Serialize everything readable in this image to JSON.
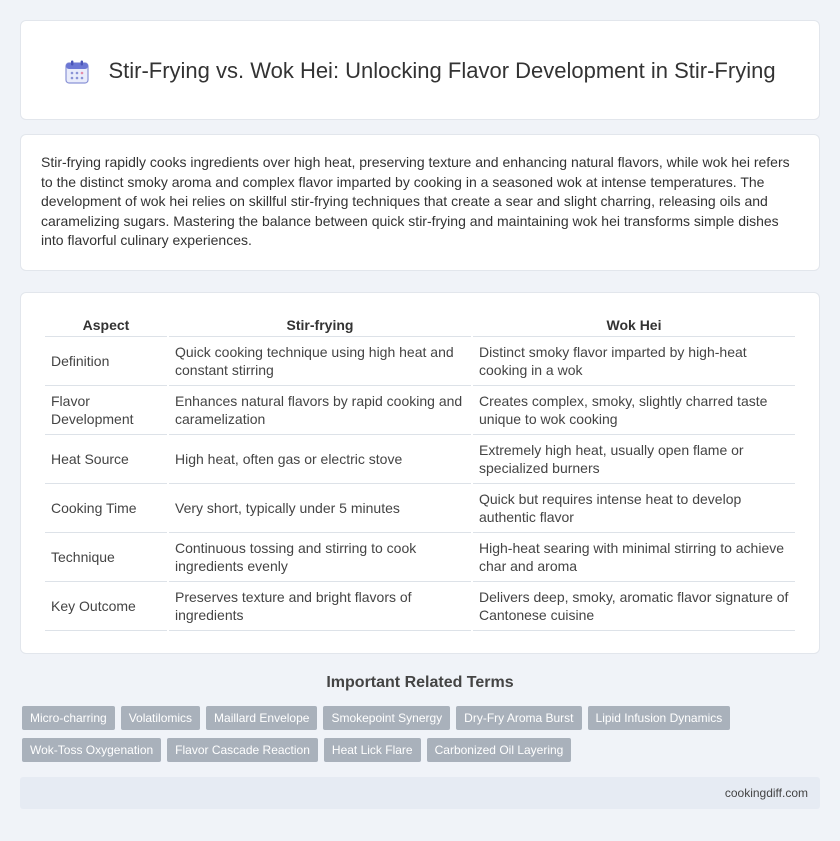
{
  "header": {
    "title": "Stir-Frying vs. Wok Hei: Unlocking Flavor Development in Stir-Frying",
    "icon": "calendar-icon"
  },
  "intro": {
    "text": "Stir-frying rapidly cooks ingredients over high heat, preserving texture and enhancing natural flavors, while wok hei refers to the distinct smoky aroma and complex flavor imparted by cooking in a seasoned wok at intense temperatures. The development of wok hei relies on skillful stir-frying techniques that create a sear and slight charring, releasing oils and caramelizing sugars. Mastering the balance between quick stir-frying and maintaining wok hei transforms simple dishes into flavorful culinary experiences."
  },
  "table": {
    "headers": [
      "Aspect",
      "Stir-frying",
      "Wok Hei"
    ],
    "rows": [
      [
        "Definition",
        "Quick cooking technique using high heat and constant stirring",
        "Distinct smoky flavor imparted by high-heat cooking in a wok"
      ],
      [
        "Flavor Development",
        "Enhances natural flavors by rapid cooking and caramelization",
        "Creates complex, smoky, slightly charred taste unique to wok cooking"
      ],
      [
        "Heat Source",
        "High heat, often gas or electric stove",
        "Extremely high heat, usually open flame or specialized burners"
      ],
      [
        "Cooking Time",
        "Very short, typically under 5 minutes",
        "Quick but requires intense heat to develop authentic flavor"
      ],
      [
        "Technique",
        "Continuous tossing and stirring to cook ingredients evenly",
        "High-heat searing with minimal stirring to achieve char and aroma"
      ],
      [
        "Key Outcome",
        "Preserves texture and bright flavors of ingredients",
        "Delivers deep, smoky, aromatic flavor signature of Cantonese cuisine"
      ]
    ]
  },
  "related": {
    "title": "Important Related Terms",
    "tags": [
      "Micro-charring",
      "Volatilomics",
      "Maillard Envelope",
      "Smokepoint Synergy",
      "Dry-Fry Aroma Burst",
      "Lipid Infusion Dynamics",
      "Wok-Toss Oxygenation",
      "Flavor Cascade Reaction",
      "Heat Lick Flare",
      "Carbonized Oil Layering"
    ]
  },
  "footer": {
    "site": "cookingdiff.com"
  },
  "colors": {
    "background": "#f0f3f8",
    "tag": "#a9b1bb",
    "footer": "#e6ebf3"
  }
}
